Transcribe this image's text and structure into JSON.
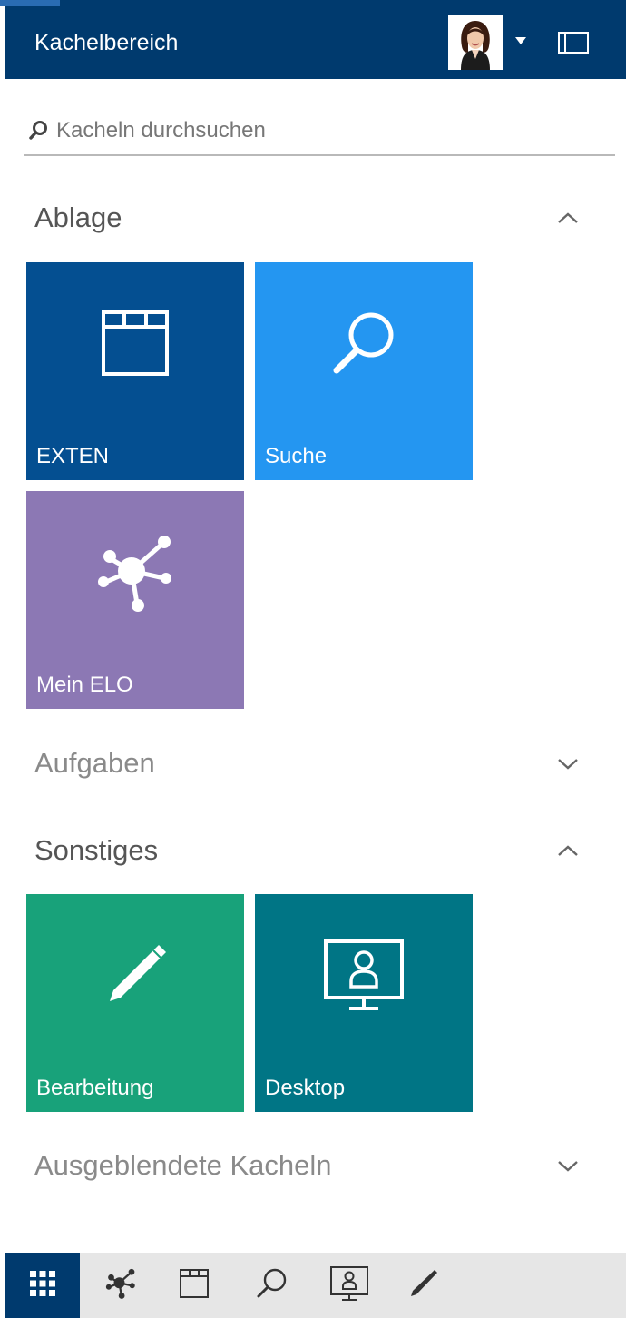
{
  "header": {
    "title": "Kachelbereich",
    "avatar_icon": "user-avatar",
    "menu_icon": "caret-down-icon",
    "panel_icon": "panel-toggle-icon"
  },
  "search": {
    "placeholder": "Kacheln durchsuchen",
    "value": ""
  },
  "sections": {
    "ablage": {
      "title": "Ablage",
      "state": "expanded"
    },
    "aufgaben": {
      "title": "Aufgaben",
      "state": "collapsed"
    },
    "sonstiges": {
      "title": "Sonstiges",
      "state": "expanded"
    },
    "ausgeblendet": {
      "title": "Ausgeblendete Kacheln",
      "state": "collapsed"
    }
  },
  "tiles": {
    "exten": {
      "label": "EXTEN",
      "color": "#044f91",
      "icon": "window-icon"
    },
    "suche": {
      "label": "Suche",
      "color": "#2496f1",
      "icon": "search-icon"
    },
    "mein_elo": {
      "label": "Mein ELO",
      "color": "#8c78b4",
      "icon": "network-icon"
    },
    "bearbeitung": {
      "label": "Bearbeitung",
      "color": "#18a27a",
      "icon": "pencil-icon"
    },
    "desktop": {
      "label": "Desktop",
      "color": "#007585",
      "icon": "monitor-user-icon"
    }
  },
  "bottombar": {
    "items": [
      "tiles-grid-icon",
      "network-icon",
      "window-icon",
      "search-icon",
      "monitor-user-icon",
      "pencil-icon"
    ],
    "active": "tiles-grid-icon"
  },
  "colors": {
    "header_bg": "#003a6e",
    "accent": "#2a6cb3",
    "bottombar_bg": "#e6e6e6"
  }
}
